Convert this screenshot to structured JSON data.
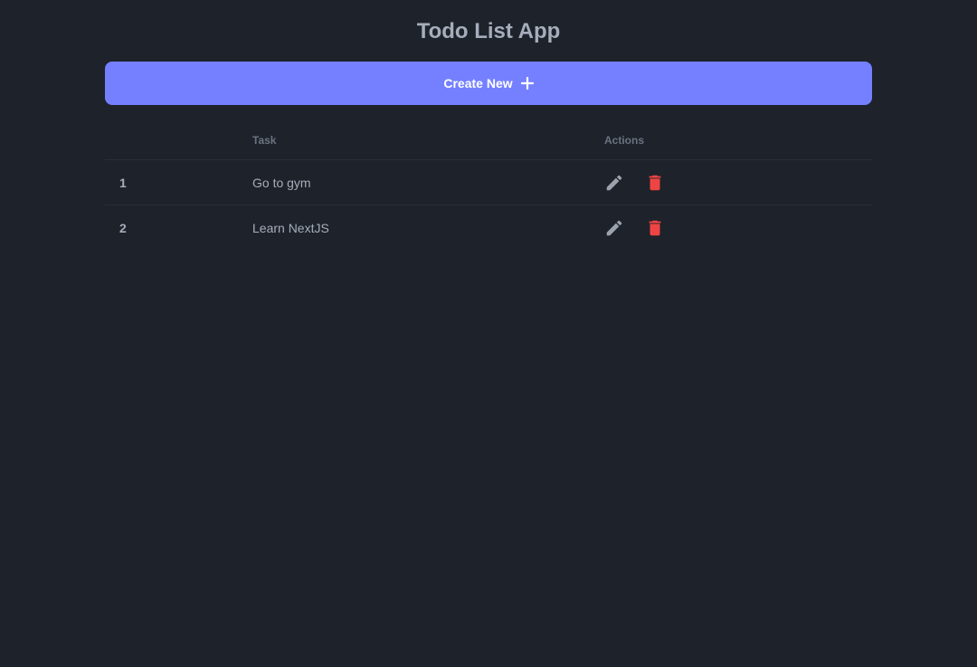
{
  "app": {
    "title": "Todo List App"
  },
  "toolbar": {
    "create_label": "Create New",
    "create_icon": "plus-icon",
    "create_color": "#7480ff"
  },
  "table": {
    "columns": [
      "",
      "Task",
      "Actions"
    ],
    "rows": [
      {
        "num": "1",
        "task": "Go to gym"
      },
      {
        "num": "2",
        "task": "Learn NextJS"
      }
    ],
    "edit_icon": "pencil-icon",
    "delete_icon": "trash-icon",
    "edit_color": "#9ca3af",
    "delete_color": "#ef4444"
  }
}
